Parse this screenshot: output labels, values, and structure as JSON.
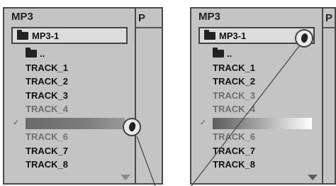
{
  "left_panel": {
    "title": "MP3",
    "folder": "MP3-1",
    "tab_letter": "P",
    "items": [
      {
        "label": "..",
        "type": "folder-up",
        "dim": false,
        "checked": false,
        "selected": false
      },
      {
        "label": "TRACK_1",
        "dim": false,
        "checked": false,
        "selected": false
      },
      {
        "label": "TRACK_2",
        "dim": false,
        "checked": false,
        "selected": false
      },
      {
        "label": "TRACK_3",
        "dim": false,
        "checked": false,
        "selected": false
      },
      {
        "label": "TRACK_4",
        "dim": true,
        "checked": false,
        "selected": false
      },
      {
        "label": "",
        "dim": false,
        "checked": true,
        "selected": true
      },
      {
        "label": "TRACK_6",
        "dim": true,
        "checked": false,
        "selected": false
      },
      {
        "label": "TRACK_7",
        "dim": false,
        "checked": false,
        "selected": false
      },
      {
        "label": "TRACK_8",
        "dim": false,
        "checked": false,
        "selected": false
      }
    ]
  },
  "right_panel": {
    "title": "MP3",
    "folder": "MP3-1",
    "tab_letter": "P",
    "items": [
      {
        "label": "..",
        "type": "folder-up",
        "dim": false,
        "checked": false,
        "selected": false
      },
      {
        "label": "TRACK_1",
        "dim": false,
        "checked": false,
        "selected": false
      },
      {
        "label": "TRACK_2",
        "dim": false,
        "checked": false,
        "selected": false
      },
      {
        "label": "TRACK_3",
        "dim": true,
        "checked": false,
        "selected": false
      },
      {
        "label": "TRACK_4",
        "dim": true,
        "checked": false,
        "selected": false
      },
      {
        "label": "",
        "dim": false,
        "checked": true,
        "selected": true
      },
      {
        "label": "TRACK_6",
        "dim": true,
        "checked": false,
        "selected": false
      },
      {
        "label": "TRACK_7",
        "dim": false,
        "checked": false,
        "selected": false
      },
      {
        "label": "TRACK_8",
        "dim": false,
        "checked": false,
        "selected": false
      }
    ]
  },
  "check_mark": "✓",
  "cursor_icon": "drag-hand-icon",
  "colors": {
    "panel_bg": "#c4c4c4",
    "border": "#4a4a4a",
    "dim_text": "#6e6e6e"
  }
}
